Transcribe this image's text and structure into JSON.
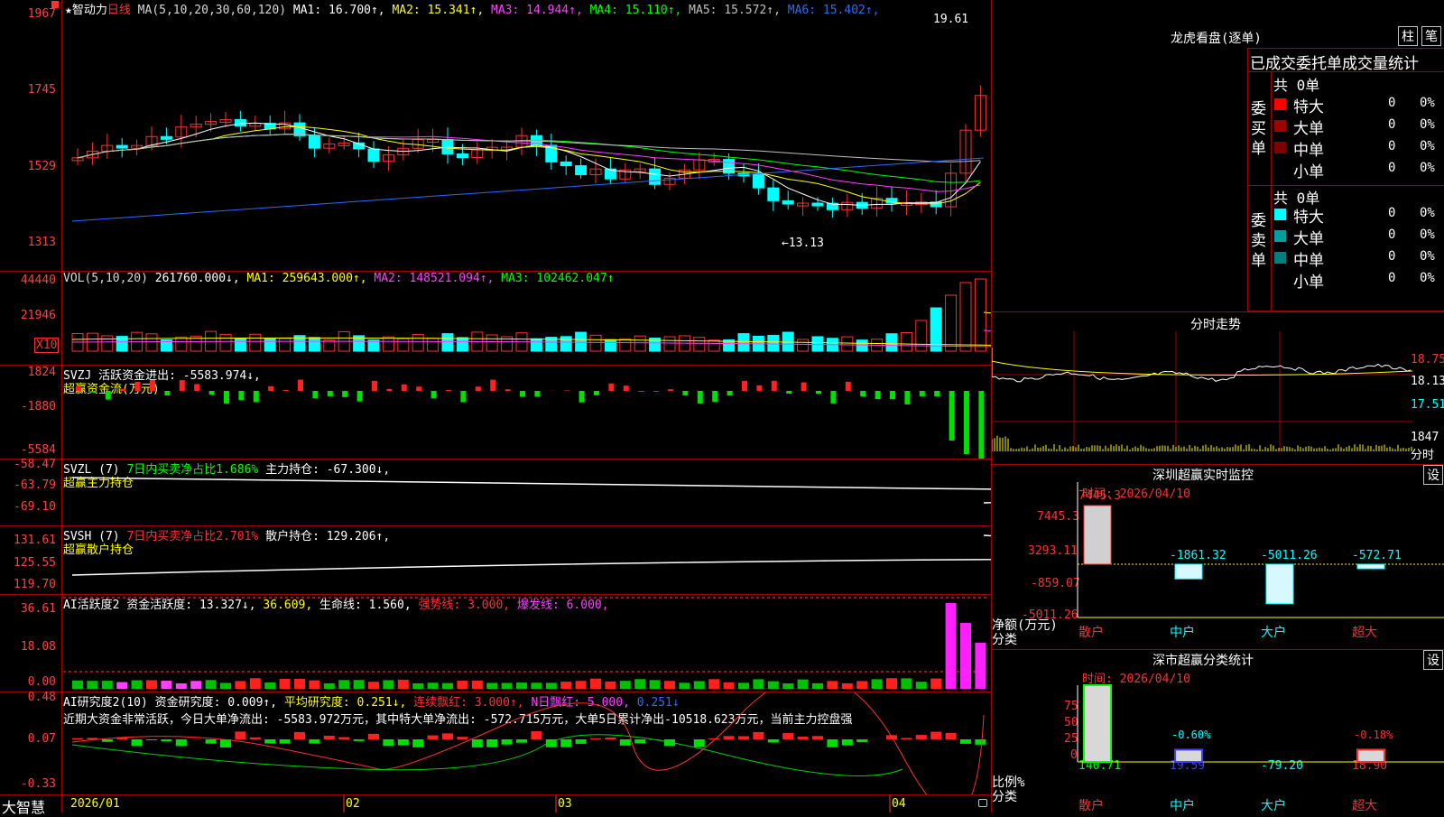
{
  "main": {
    "stock_title": "★智动力",
    "period": "日线",
    "ma_header": "MA(5,10,20,30,60,120)",
    "ma_values": [
      {
        "name": "MA1",
        "value": "16.700↑",
        "color": "#ffffff"
      },
      {
        "name": "MA2",
        "value": "15.341↑",
        "color": "#ffff00"
      },
      {
        "name": "MA3",
        "value": "14.944↑",
        "color": "#ff40ff"
      },
      {
        "name": "MA4",
        "value": "15.110↑",
        "color": "#00ff00"
      },
      {
        "name": "MA5",
        "value": "15.572↑",
        "color": "#c0c0c0"
      },
      {
        "name": "MA6",
        "value": "15.402↑",
        "color": "#2a6bff"
      }
    ],
    "y_labels": [
      "1967",
      "1745",
      "1529",
      "1313"
    ],
    "high_label": "19.61",
    "low_label": "←13.13"
  },
  "vol": {
    "title": "VOL(5,10,20)",
    "value": "261760.000↓,",
    "ma1": "MA1: 259643.000↑,",
    "ma2": "MA2: 148521.094↑,",
    "ma3": "MA3: 102462.047↑",
    "y_labels": [
      "44440",
      "21946"
    ],
    "unit": "X10"
  },
  "svzj": {
    "title": "SVZJ  活跃资金进出: -5583.974↓,",
    "sub": "超赢资金流(万元)",
    "y_labels": [
      "1824",
      "-1880",
      "-5584"
    ]
  },
  "svzl": {
    "title": "SVZL (7)",
    "ratio": "7日内买卖净占比1.686%",
    "hold": "主力持仓: -67.300↓,",
    "sub": "超赢主力持仓",
    "y_labels": [
      "-58.47",
      "-63.79",
      "-69.10"
    ]
  },
  "svsh": {
    "title": "SVSH (7)",
    "ratio": "7日内买卖净占比2.701%",
    "hold": "散户持仓: 129.206↑,",
    "sub": "超赢散户持仓",
    "y_labels": [
      "131.61",
      "125.55",
      "119.70"
    ]
  },
  "ai1": {
    "title": "AI活跃度2 资金活跃度: 13.327↓,",
    "v2": "36.609,",
    "life": "生命线: 1.560,",
    "strong": "强势线: 3.000,",
    "burst": "爆发线: 6.000,",
    "y_labels": [
      "36.61",
      "18.08",
      "0.00"
    ]
  },
  "ai2": {
    "title": "AI研究度2(10) 资金研究度: 0.009↑,",
    "avg": "平均研究度: 0.251↓,",
    "cont": "连续飘红: 3.000↑,",
    "nday": "N日飘红: 5.000,",
    "last": "0.251↓",
    "comment": "近期大资金非常活跃，今日大单净流出: -5583.972万元，其中特大单净流出: -572.715万元，大单5日累计净出-10518.623万元，当前主力控盘强",
    "y_labels": [
      "0.48",
      "0.07",
      "-0.33"
    ]
  },
  "bottom_bar": {
    "brand": "大智慧",
    "dates": [
      "2026/01",
      "02",
      "03",
      "04"
    ]
  },
  "longhu": {
    "title": "龙虎看盘(逐单)",
    "btn1": "柱",
    "btn2": "笔",
    "header": "已成交委托单成交量统计",
    "buy_label": "委买单",
    "sell_label": "委卖单",
    "buy_total": "共 0单",
    "sell_total": "共 0单",
    "buy_rows": [
      {
        "name": "特大",
        "count": "0",
        "pct": "0%",
        "color": "#ff0000"
      },
      {
        "name": "大单",
        "count": "0",
        "pct": "0%",
        "color": "#a00000"
      },
      {
        "name": "中单",
        "count": "0",
        "pct": "0%",
        "color": "#800000"
      },
      {
        "name": "小单",
        "count": "0",
        "pct": "0%",
        "color": ""
      }
    ],
    "sell_rows": [
      {
        "name": "特大",
        "count": "0",
        "pct": "0%",
        "color": "#00ffff"
      },
      {
        "name": "大单",
        "count": "0",
        "pct": "0%",
        "color": "#00a0a0"
      },
      {
        "name": "中单",
        "count": "0",
        "pct": "0%",
        "color": "#008080"
      },
      {
        "name": "小单",
        "count": "0",
        "pct": "0%",
        "color": ""
      }
    ]
  },
  "intraday": {
    "title": "分时走势",
    "y_labels": [
      "18.75",
      "18.13",
      "17.51"
    ],
    "vol_label": "1847",
    "vol_unit": "分时"
  },
  "monitor": {
    "title": "深圳超赢实时监控",
    "btn": "设",
    "time": "时间: 2026/04/10",
    "y_labels": [
      "7445.3",
      "3293.11",
      "-859.07",
      "-5011.26"
    ],
    "unit1": "净额(万元)",
    "unit2": "分类",
    "categories": [
      "散户",
      "中户",
      "大户",
      "超大"
    ],
    "values": [
      "7445.3",
      "-1861.32",
      "-5011.26",
      "-572.71"
    ]
  },
  "classstat": {
    "title": "深市超赢分类统计",
    "btn": "设",
    "time": "时间: 2026/04/10",
    "y_labels": [
      "75",
      "50",
      "25",
      "0"
    ],
    "unit1": "比例%",
    "unit2": "分类",
    "categories": [
      "散户",
      "中户",
      "大户",
      "超大"
    ],
    "top_labels": [
      "",
      "-0.60%",
      "",
      "-0.18%"
    ],
    "bottom_labels": [
      "140.71",
      "19.59",
      "-79.20",
      "18.90"
    ]
  }
}
